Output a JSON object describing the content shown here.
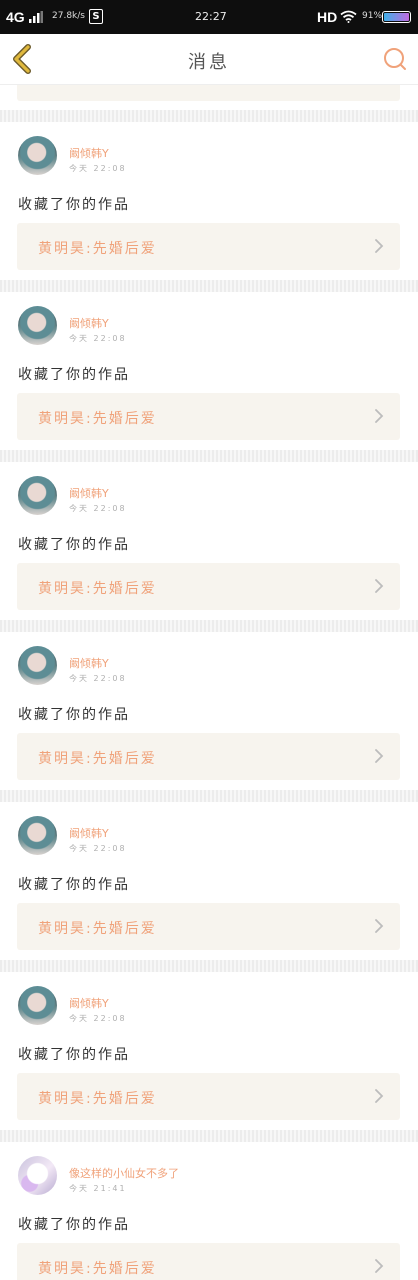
{
  "status_bar": {
    "network": "4G",
    "speed": "27.8k/s",
    "s_badge": "S",
    "time": "22:27",
    "hd": "HD",
    "battery": "91%"
  },
  "header": {
    "title": "消息"
  },
  "notifications": [
    {
      "user": "阚倾韩Y",
      "time": "今天 22:08",
      "action": "收藏了你的作品",
      "work": "黄明昊:先婚后爱",
      "avatar": "a"
    },
    {
      "user": "阚倾韩Y",
      "time": "今天 22:08",
      "action": "收藏了你的作品",
      "work": "黄明昊:先婚后爱",
      "avatar": "a"
    },
    {
      "user": "阚倾韩Y",
      "time": "今天 22:08",
      "action": "收藏了你的作品",
      "work": "黄明昊:先婚后爱",
      "avatar": "a"
    },
    {
      "user": "阚倾韩Y",
      "time": "今天 22:08",
      "action": "收藏了你的作品",
      "work": "黄明昊:先婚后爱",
      "avatar": "a"
    },
    {
      "user": "阚倾韩Y",
      "time": "今天 22:08",
      "action": "收藏了你的作品",
      "work": "黄明昊:先婚后爱",
      "avatar": "a"
    },
    {
      "user": "阚倾韩Y",
      "time": "今天 22:08",
      "action": "收藏了你的作品",
      "work": "黄明昊:先婚后爱",
      "avatar": "a"
    },
    {
      "user": "像这样的小仙女不多了",
      "time": "今天 21:41",
      "action": "收藏了你的作品",
      "work": "黄明昊:先婚后爱",
      "avatar": "b"
    }
  ],
  "colors": {
    "accent": "#f0a27a",
    "back_icon": "#c9a43a",
    "link_bg": "#f7f4ee"
  },
  "icons": {
    "back": "chevron-left-icon",
    "search": "search-icon",
    "link_arrow": "chevron-right-icon"
  }
}
